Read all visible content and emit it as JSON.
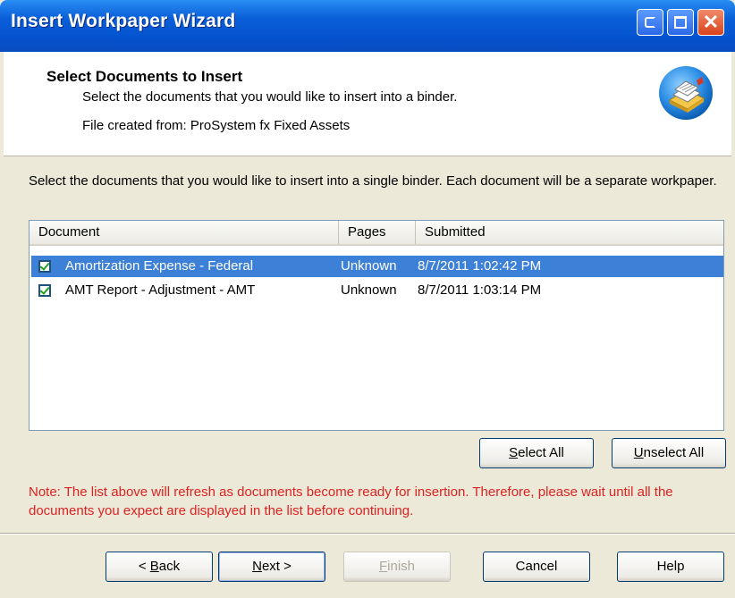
{
  "window": {
    "title": "Insert Workpaper Wizard"
  },
  "header": {
    "title": "Select Documents to Insert",
    "subtitle": "Select the documents that you would like to insert into a binder.",
    "file_created": "File created from: ProSystem fx Fixed Assets"
  },
  "intro_text": "Select the documents that you would like to insert into a single binder.  Each document will be a separate workpaper.",
  "list": {
    "columns": [
      "Document",
      "Pages",
      "Submitted"
    ],
    "rows": [
      {
        "document": "Amortization Expense - Federal",
        "pages": "Unknown",
        "submitted": "8/7/2011 1:02:42 PM",
        "checked": true,
        "selected": true
      },
      {
        "document": "AMT Report - Adjustment - AMT",
        "pages": "Unknown",
        "submitted": "8/7/2011 1:03:14 PM",
        "checked": true,
        "selected": false
      }
    ]
  },
  "buttons": {
    "select_all": {
      "accel": "S",
      "rest": "elect All"
    },
    "unselect_all": {
      "accel": "U",
      "rest": "nselect All"
    },
    "back": {
      "prefix": "< ",
      "accel": "B",
      "rest": "ack"
    },
    "next": {
      "accel": "N",
      "rest": "ext >"
    },
    "finish": {
      "accel": "F",
      "rest": "inish"
    },
    "cancel": "Cancel",
    "help": "Help"
  },
  "note_text": "Note: The list above will refresh as documents become ready for insertion.  Therefore, please wait until all the documents you expect are displayed in the list before continuing.",
  "colors": {
    "titlebar": "#0a5fd8",
    "selection": "#3d80d8",
    "note": "#dd2222",
    "dialog_bg": "#ece9d8"
  }
}
